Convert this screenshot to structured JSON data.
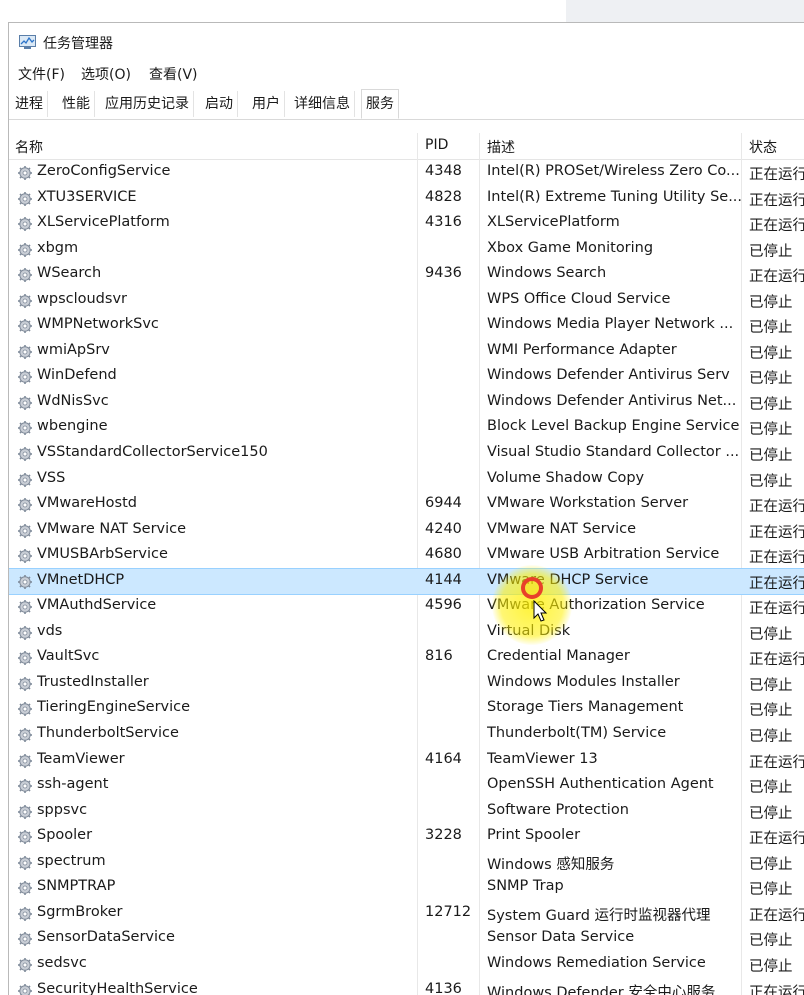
{
  "window": {
    "title": "任务管理器"
  },
  "menu": [
    "文件(F)",
    "选项(O)",
    "查看(V)"
  ],
  "tabs": [
    "进程",
    "性能",
    "应用历史记录",
    "启动",
    "用户",
    "详细信息",
    "服务"
  ],
  "active_tab": "服务",
  "columns": {
    "name": "名称",
    "pid": "PID",
    "desc": "描述",
    "status": "状态"
  },
  "rows": [
    {
      "name": "ZeroConfigService",
      "pid": "4348",
      "desc": "Intel(R) PROSet/Wireless Zero Co...",
      "status": "正在运行"
    },
    {
      "name": "XTU3SERVICE",
      "pid": "4828",
      "desc": "Intel(R) Extreme Tuning Utility Se...",
      "status": "正在运行"
    },
    {
      "name": "XLServicePlatform",
      "pid": "4316",
      "desc": "XLServicePlatform",
      "status": "正在运行"
    },
    {
      "name": "xbgm",
      "pid": "",
      "desc": "Xbox Game Monitoring",
      "status": "已停止"
    },
    {
      "name": "WSearch",
      "pid": "9436",
      "desc": "Windows Search",
      "status": "正在运行"
    },
    {
      "name": "wpscloudsvr",
      "pid": "",
      "desc": "WPS Office Cloud Service",
      "status": "已停止"
    },
    {
      "name": "WMPNetworkSvc",
      "pid": "",
      "desc": "Windows Media Player Network ...",
      "status": "已停止"
    },
    {
      "name": "wmiApSrv",
      "pid": "",
      "desc": "WMI Performance Adapter",
      "status": "已停止"
    },
    {
      "name": "WinDefend",
      "pid": "",
      "desc": "Windows Defender Antivirus Serv",
      "status": "已停止"
    },
    {
      "name": "WdNisSvc",
      "pid": "",
      "desc": "Windows Defender Antivirus Net...",
      "status": "已停止"
    },
    {
      "name": "wbengine",
      "pid": "",
      "desc": "Block Level Backup Engine Service",
      "status": "已停止"
    },
    {
      "name": "VSStandardCollectorService150",
      "pid": "",
      "desc": "Visual Studio Standard Collector ...",
      "status": "已停止"
    },
    {
      "name": "VSS",
      "pid": "",
      "desc": "Volume Shadow Copy",
      "status": "已停止"
    },
    {
      "name": "VMwareHostd",
      "pid": "6944",
      "desc": "VMware Workstation Server",
      "status": "正在运行"
    },
    {
      "name": "VMware NAT Service",
      "pid": "4240",
      "desc": "VMware NAT Service",
      "status": "正在运行"
    },
    {
      "name": "VMUSBArbService",
      "pid": "4680",
      "desc": "VMware USB Arbitration Service",
      "status": "正在运行"
    },
    {
      "name": "VMnetDHCP",
      "pid": "4144",
      "desc": "VMware DHCP Service",
      "status": "正在运行",
      "selected": true
    },
    {
      "name": "VMAuthdService",
      "pid": "4596",
      "desc": "VMware Authorization Service",
      "status": "正在运行"
    },
    {
      "name": "vds",
      "pid": "",
      "desc": "Virtual Disk",
      "status": "已停止"
    },
    {
      "name": "VaultSvc",
      "pid": "816",
      "desc": "Credential Manager",
      "status": "正在运行"
    },
    {
      "name": "TrustedInstaller",
      "pid": "",
      "desc": "Windows Modules Installer",
      "status": "已停止"
    },
    {
      "name": "TieringEngineService",
      "pid": "",
      "desc": "Storage Tiers Management",
      "status": "已停止"
    },
    {
      "name": "ThunderboltService",
      "pid": "",
      "desc": "Thunderbolt(TM) Service",
      "status": "已停止"
    },
    {
      "name": "TeamViewer",
      "pid": "4164",
      "desc": "TeamViewer 13",
      "status": "正在运行"
    },
    {
      "name": "ssh-agent",
      "pid": "",
      "desc": "OpenSSH Authentication Agent",
      "status": "已停止"
    },
    {
      "name": "sppsvc",
      "pid": "",
      "desc": "Software Protection",
      "status": "已停止"
    },
    {
      "name": "Spooler",
      "pid": "3228",
      "desc": "Print Spooler",
      "status": "正在运行"
    },
    {
      "name": "spectrum",
      "pid": "",
      "desc": "Windows 感知服务",
      "status": "已停止"
    },
    {
      "name": "SNMPTRAP",
      "pid": "",
      "desc": "SNMP Trap",
      "status": "已停止"
    },
    {
      "name": "SgrmBroker",
      "pid": "12712",
      "desc": "System Guard 运行时监视器代理",
      "status": "正在运行"
    },
    {
      "name": "SensorDataService",
      "pid": "",
      "desc": "Sensor Data Service",
      "status": "已停止"
    },
    {
      "name": "sedsvc",
      "pid": "",
      "desc": "Windows Remediation Service",
      "status": "已停止"
    },
    {
      "name": "SecurityHealthService",
      "pid": "4136",
      "desc": "Windows Defender 安全中心服务",
      "status": "正在运行"
    }
  ],
  "icons": {
    "service": "gear-icon",
    "app": "task-manager-icon"
  },
  "colors": {
    "selected_row": "#cce8ff",
    "cursor_highlight": "#fff000"
  }
}
